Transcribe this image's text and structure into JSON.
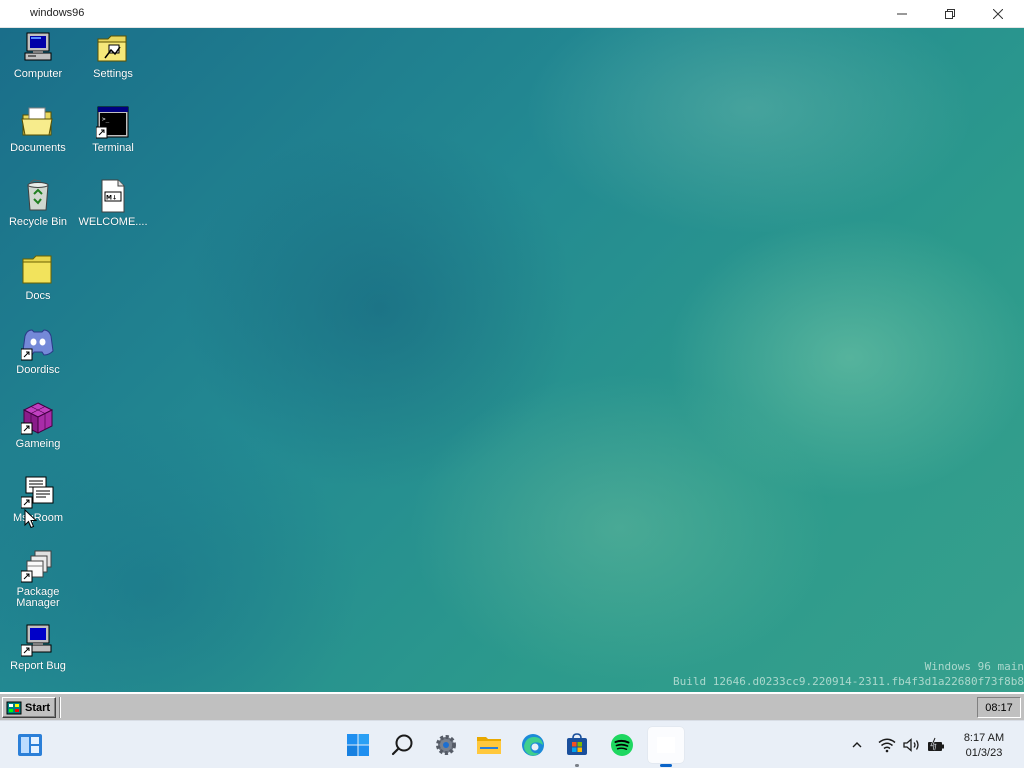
{
  "window": {
    "title": "windows96"
  },
  "desktop": {
    "icons": [
      {
        "label": "Computer",
        "icon": "computer-icon"
      },
      {
        "label": "Settings",
        "icon": "settings-folder-icon"
      },
      {
        "label": "Documents",
        "icon": "documents-folder-icon"
      },
      {
        "label": "Terminal",
        "icon": "terminal-icon"
      },
      {
        "label": "Recycle Bin",
        "icon": "recycle-bin-icon"
      },
      {
        "label": "WELCOME....",
        "icon": "markdown-file-icon"
      },
      {
        "label": "Docs",
        "icon": "folder-icon"
      },
      {
        "label": "Doordisc",
        "icon": "doordisc-icon"
      },
      {
        "label": "Gameing",
        "icon": "cube-icon"
      },
      {
        "label": "MsgRoom",
        "icon": "msgroom-icon"
      },
      {
        "label_line1": "Package",
        "label_line2": "Manager",
        "icon": "package-manager-icon"
      },
      {
        "label": "Report Bug",
        "icon": "report-bug-icon"
      }
    ],
    "build_line1": "Windows 96 main",
    "build_line2": "Build 12646.d0233cc9.220914-2311.fb4f3d1a22680f73f8b8"
  },
  "w96_taskbar": {
    "start_label": "Start",
    "clock": "08:17"
  },
  "w11_taskbar": {
    "apps": [
      "widgets-icon",
      "windows-start-icon",
      "search-icon",
      "settings-icon",
      "file-explorer-icon",
      "edge-icon",
      "store-icon",
      "spotify-icon",
      "active-window-icon"
    ],
    "time": "8:17 AM",
    "date": "01/3/23"
  },
  "colors": {
    "desktop": "#238a92",
    "accent": "#0a64c8",
    "win96_gray": "#c0c0c0"
  }
}
